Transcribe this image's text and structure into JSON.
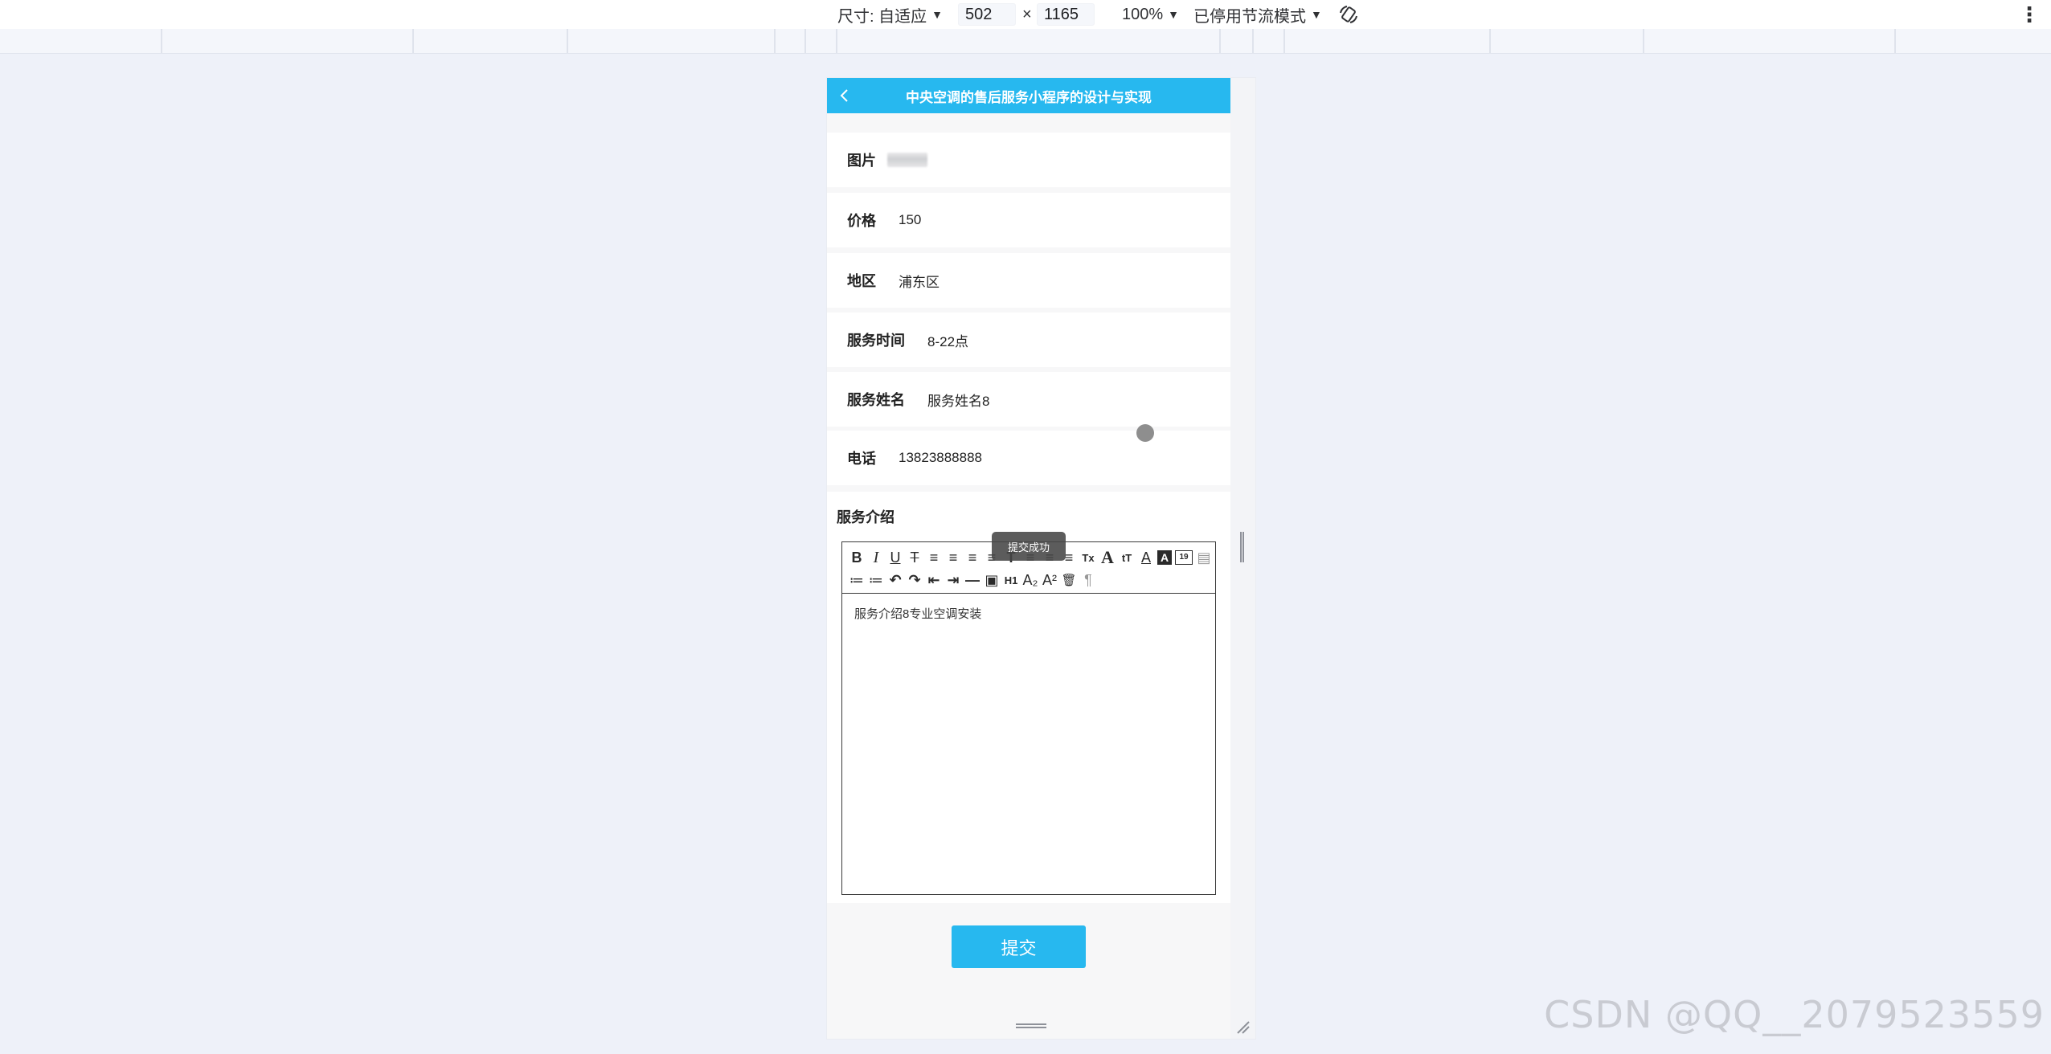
{
  "devtools": {
    "size_label": "尺寸: 自适应",
    "width_value": "502",
    "times": "×",
    "height_value": "1165",
    "zoom": "100%",
    "throttle": "已停用节流模式",
    "menu": "⋮"
  },
  "app": {
    "title": "中央空调的售后服务小程序的设计与实现"
  },
  "form": {
    "image_label": "图片",
    "price_label": "价格",
    "price_value": "150",
    "region_label": "地区",
    "region_value": "浦东区",
    "time_label": "服务时间",
    "time_value": "8-22点",
    "name_label": "服务姓名",
    "name_value": "服务姓名8",
    "phone_label": "电话",
    "phone_value": "13823888888",
    "intro_label": "服务介绍",
    "intro_content": "服务介绍8专业空调安装"
  },
  "toolbar": {
    "row1": [
      "B",
      "I",
      "U",
      "T",
      "≡",
      "≡",
      "≡",
      "≡",
      "T",
      "≡",
      "≡",
      "≡",
      "Tx",
      "A",
      "tT",
      "A",
      "A",
      "19",
      "▤"
    ],
    "row2": [
      "≔",
      "≔",
      "↶",
      "↷",
      "⇤",
      "⇥",
      "—",
      "▣",
      "H1",
      "A₂",
      "A²",
      "🗑",
      "¶"
    ]
  },
  "toast": "提交成功",
  "submit_label": "提交",
  "watermark": "CSDN @QQ__2079523559"
}
